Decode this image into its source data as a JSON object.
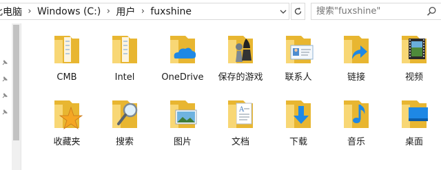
{
  "address_bar": {
    "crumbs": [
      "此电脑",
      "Windows (C:)",
      "用户",
      "fuxshine"
    ]
  },
  "search": {
    "placeholder": "搜索\"fuxshine\""
  },
  "folders": [
    {
      "label": "CMB",
      "icon": "folder-icon"
    },
    {
      "label": "Intel",
      "icon": "folder-icon"
    },
    {
      "label": "OneDrive",
      "icon": "onedrive-folder-icon"
    },
    {
      "label": "保存的游戏",
      "icon": "saved-games-folder-icon"
    },
    {
      "label": "联系人",
      "icon": "contacts-folder-icon"
    },
    {
      "label": "链接",
      "icon": "links-folder-icon"
    },
    {
      "label": "视频",
      "icon": "videos-folder-icon"
    },
    {
      "label": "收藏夹",
      "icon": "favorites-folder-icon"
    },
    {
      "label": "搜索",
      "icon": "searches-folder-icon"
    },
    {
      "label": "图片",
      "icon": "pictures-folder-icon"
    },
    {
      "label": "文档",
      "icon": "documents-folder-icon"
    },
    {
      "label": "下载",
      "icon": "downloads-folder-icon"
    },
    {
      "label": "音乐",
      "icon": "music-folder-icon"
    },
    {
      "label": "桌面",
      "icon": "desktop-folder-icon"
    }
  ],
  "colors": {
    "folder_back": "#e8b631",
    "folder_front": "#f8d775",
    "accent_blue": "#1e88e5"
  }
}
